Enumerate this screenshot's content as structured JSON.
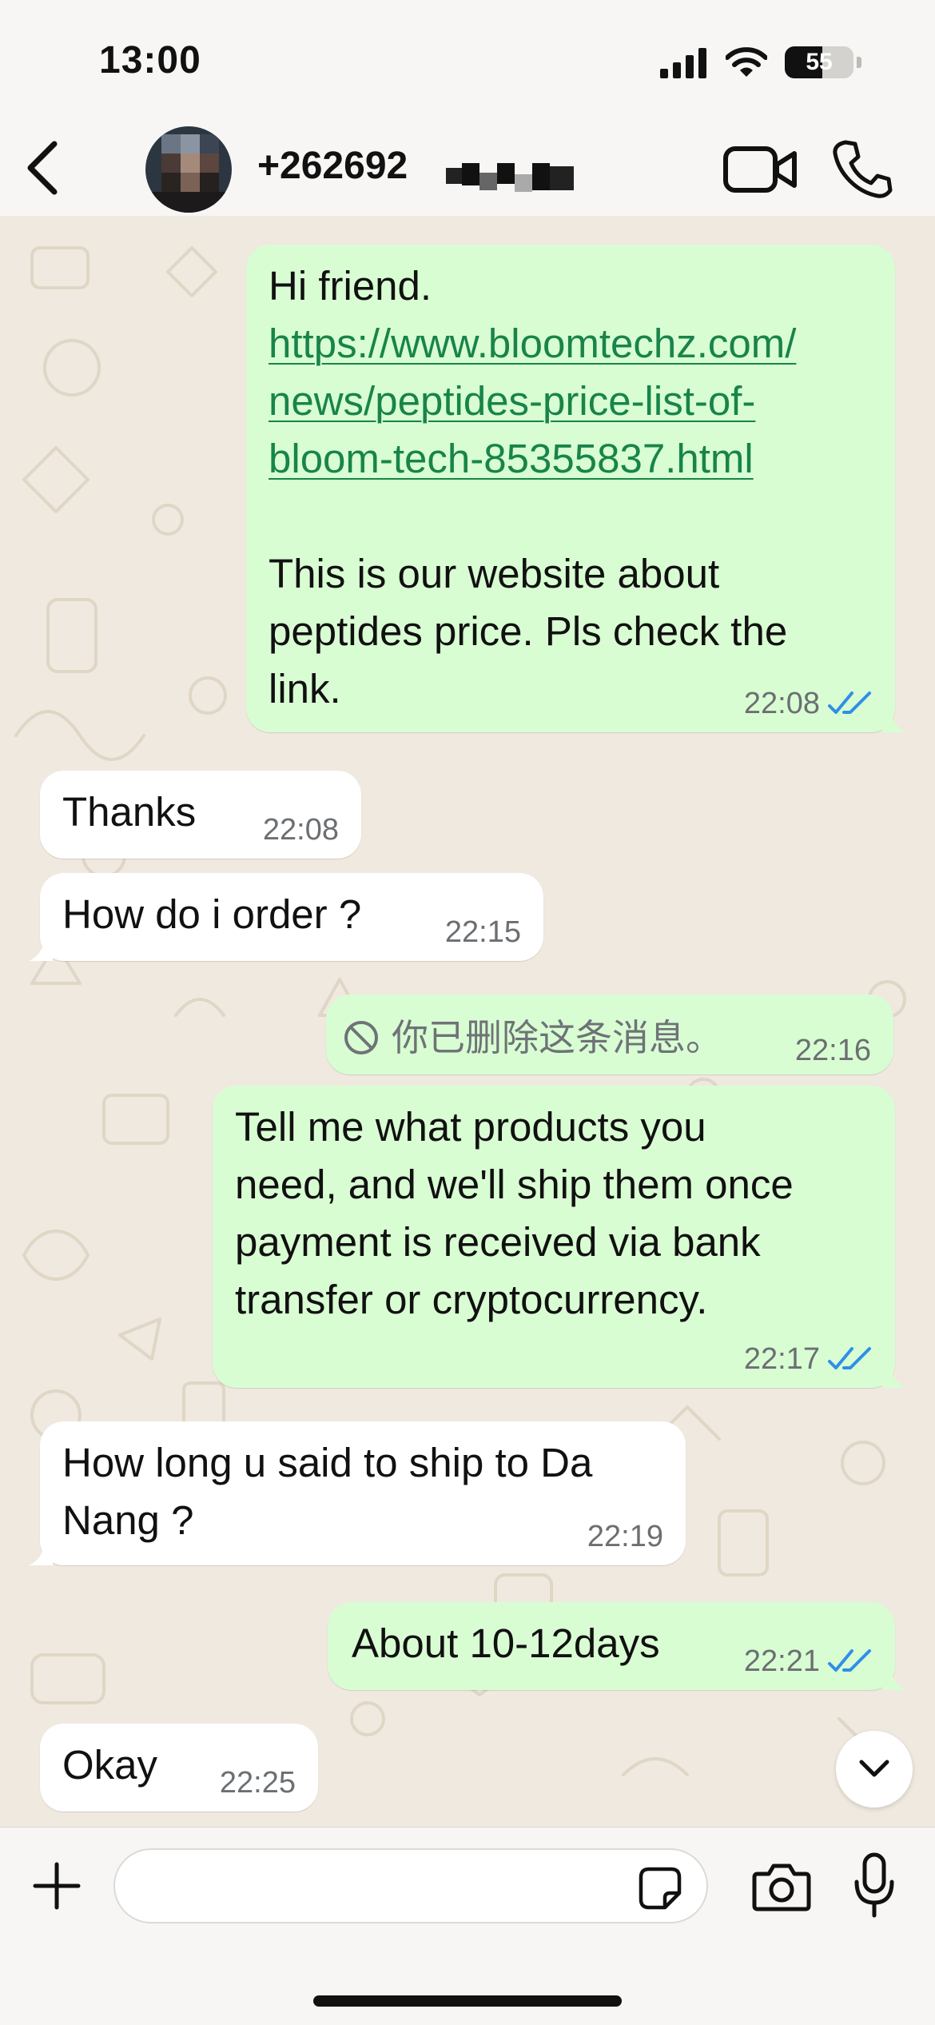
{
  "status_bar": {
    "time": "13:00",
    "battery_level": "55",
    "battery_fraction": 0.55
  },
  "header": {
    "contact_name": "+262692",
    "icons": [
      "back-chevron-icon",
      "video-call-icon",
      "phone-icon"
    ]
  },
  "messages": [
    {
      "direction": "outgoing",
      "greeting": "Hi friend.",
      "link_lines": [
        "https://www.bloomtechz.com/",
        "news/peptides-price-list-of-",
        "bloom-tech-85355837.html"
      ],
      "body": "This is our website about\npeptides price. Pls check the\nlink.",
      "time": "22:08",
      "status": "read"
    },
    {
      "direction": "incoming",
      "text": "Thanks",
      "time": "22:08"
    },
    {
      "direction": "incoming",
      "text": "How do i order ?",
      "time": "22:15"
    },
    {
      "direction": "outgoing",
      "deleted": true,
      "text": "你已删除这条消息。",
      "time": "22:16"
    },
    {
      "direction": "outgoing",
      "text": "Tell me what products you\nneed, and we'll ship them once\npayment is received via bank\ntransfer or cryptocurrency.",
      "time": "22:17",
      "status": "read"
    },
    {
      "direction": "incoming",
      "text": "How long u said to ship to Da\nNang ?",
      "time": "22:19"
    },
    {
      "direction": "outgoing",
      "text": "About 10-12days",
      "time": "22:21",
      "status": "read"
    },
    {
      "direction": "incoming",
      "text": "Okay",
      "time": "22:25"
    }
  ],
  "composer": {
    "placeholder": "",
    "icons": [
      "plus-icon",
      "sticker-icon",
      "camera-icon",
      "microphone-icon"
    ]
  },
  "colors": {
    "outgoing_bubble": "#d9fdd3",
    "incoming_bubble": "#ffffff",
    "chat_background": "#efe9df",
    "read_ticks": "#2f8fe8",
    "link": "#18844a"
  }
}
